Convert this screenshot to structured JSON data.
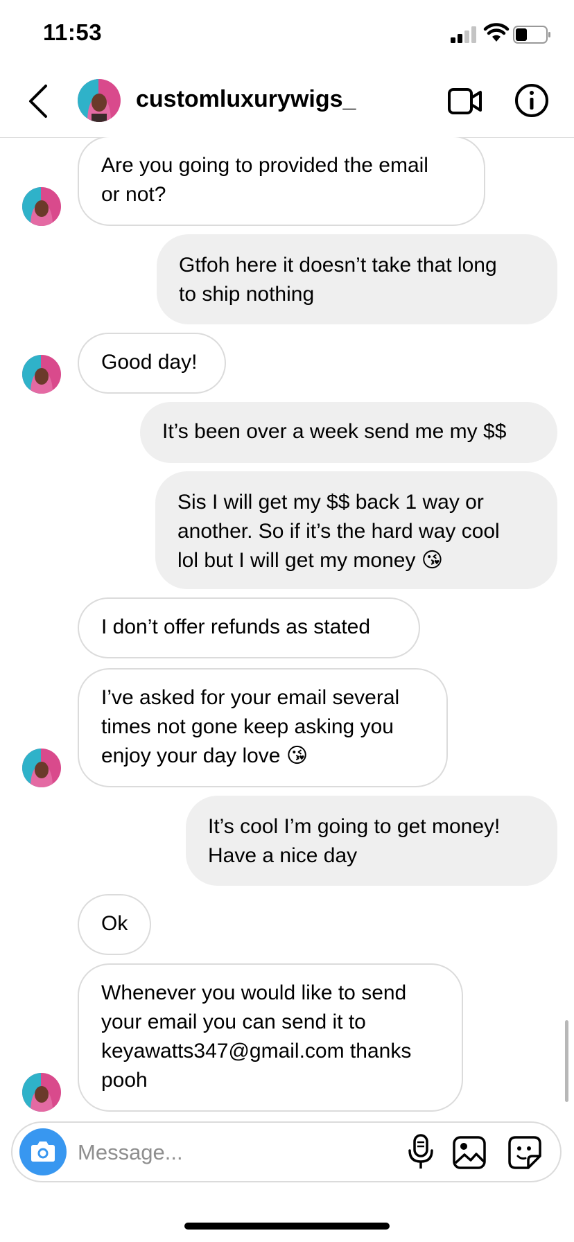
{
  "status_bar": {
    "time": "11:53"
  },
  "header": {
    "username": "customluxurywigs_"
  },
  "messages": [
    {
      "from": "them",
      "text": "Are you going to provided the email\nor not?"
    },
    {
      "from": "me",
      "text": "Gtfoh here it doesn’t take that long\nto ship nothing"
    },
    {
      "from": "them",
      "text": "Good day!"
    },
    {
      "from": "me",
      "text": "It’s been over a week send me my $$"
    },
    {
      "from": "me",
      "text": "Sis I will get my $$ back 1 way or\nanother. So if it’s the hard way cool\nlol but I will get my money 😘"
    },
    {
      "from": "them",
      "text": "I don’t offer refunds as stated"
    },
    {
      "from": "them",
      "text": "I’ve asked for your email several\ntimes not gone keep asking you\nenjoy your day love 😘"
    },
    {
      "from": "me",
      "text": "It’s cool I’m going to get money!\nHave a nice day"
    },
    {
      "from": "them",
      "text": "Ok"
    },
    {
      "from": "them",
      "text": "Whenever you would like to send\nyour email you can send it to\nkeyawatts347@gmail.com thanks\npooh"
    }
  ],
  "composer": {
    "placeholder": "Message..."
  },
  "icons": {
    "back": "chevron-left-icon",
    "video": "video-camera-icon",
    "info": "info-icon",
    "camera": "camera-icon",
    "mic": "microphone-icon",
    "gallery": "image-gallery-icon",
    "sticker": "sticker-icon"
  },
  "colors": {
    "accent": "#3897f0",
    "outgoing_bubble": "#efefef",
    "border": "#dbdbdb",
    "placeholder": "#8e8e8e"
  }
}
